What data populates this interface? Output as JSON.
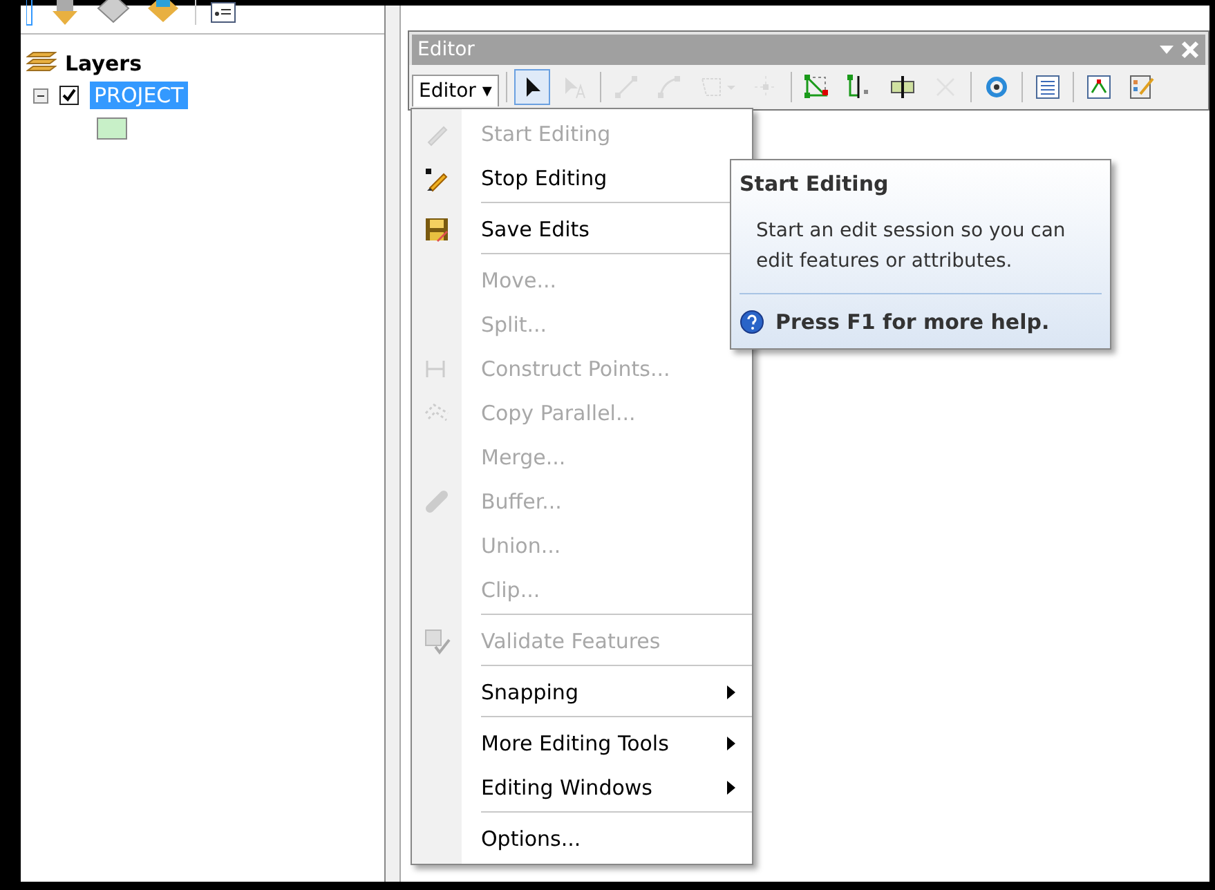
{
  "toc": {
    "heading": "Layers",
    "layers": [
      {
        "name": "PROJECT",
        "checked": true,
        "expanded": true,
        "selected": true
      }
    ]
  },
  "editor_toolbar": {
    "title": "Editor",
    "menu_button": "Editor ▾",
    "tools": [
      {
        "selected": true,
        "disabled": false
      },
      {
        "selected": false,
        "disabled": true
      },
      {
        "selected": false,
        "disabled": true
      },
      {
        "selected": false,
        "disabled": true
      },
      {
        "selected": false,
        "disabled": true
      },
      {
        "selected": false,
        "disabled": true
      },
      {
        "selected": false,
        "disabled": false
      },
      {
        "selected": false,
        "disabled": false
      },
      {
        "selected": false,
        "disabled": false
      },
      {
        "selected": false,
        "disabled": true
      },
      {
        "selected": false,
        "disabled": false
      },
      {
        "selected": false,
        "disabled": false
      },
      {
        "selected": false,
        "disabled": false
      },
      {
        "selected": false,
        "disabled": false
      }
    ]
  },
  "editor_menu": {
    "groups": [
      [
        {
          "label": "Start Editing",
          "disabled": true,
          "submenu": false
        },
        {
          "label": "Stop Editing",
          "disabled": false,
          "submenu": false
        }
      ],
      [
        {
          "label": "Save Edits",
          "disabled": false,
          "submenu": false
        }
      ],
      [
        {
          "label": "Move...",
          "disabled": true,
          "submenu": false
        },
        {
          "label": "Split...",
          "disabled": true,
          "submenu": false
        },
        {
          "label": "Construct Points...",
          "disabled": true,
          "submenu": false
        },
        {
          "label": "Copy Parallel...",
          "disabled": true,
          "submenu": false
        },
        {
          "label": "Merge...",
          "disabled": true,
          "submenu": false
        },
        {
          "label": "Buffer...",
          "disabled": true,
          "submenu": false
        },
        {
          "label": "Union...",
          "disabled": true,
          "submenu": false
        },
        {
          "label": "Clip...",
          "disabled": true,
          "submenu": false
        }
      ],
      [
        {
          "label": "Validate Features",
          "disabled": true,
          "submenu": false
        }
      ],
      [
        {
          "label": "Snapping",
          "disabled": false,
          "submenu": true
        }
      ],
      [
        {
          "label": "More Editing Tools",
          "disabled": false,
          "submenu": true
        },
        {
          "label": "Editing Windows",
          "disabled": false,
          "submenu": true
        }
      ],
      [
        {
          "label": "Options...",
          "disabled": false,
          "submenu": false
        }
      ]
    ]
  },
  "tooltip": {
    "title": "Start Editing",
    "body": "Start an edit session so you can edit features or attributes.",
    "help": "Press F1 for more help."
  }
}
